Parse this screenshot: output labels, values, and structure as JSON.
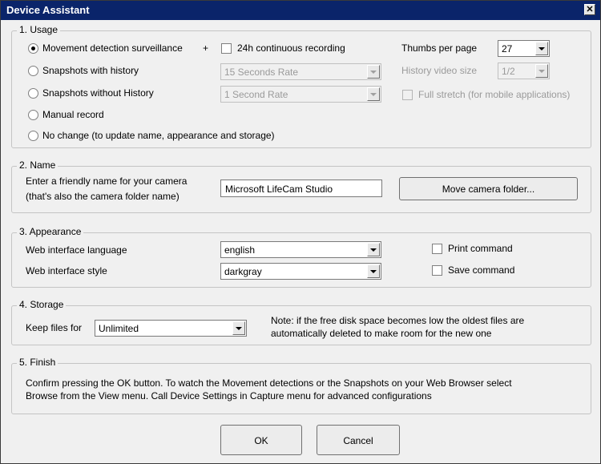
{
  "window": {
    "title": "Device Assistant",
    "close_glyph": "✕"
  },
  "usage": {
    "title": "1. Usage",
    "options": [
      {
        "label": "Movement detection surveillance",
        "selected": true
      },
      {
        "label": "Snapshots with history",
        "selected": false
      },
      {
        "label": "Snapshots without History",
        "selected": false
      },
      {
        "label": "Manual record",
        "selected": false
      },
      {
        "label": "No change (to update name, appearance and storage)",
        "selected": false
      }
    ],
    "plus": "+",
    "continuous_label": "24h continuous recording",
    "rate_with_history": "15 Seconds Rate",
    "rate_without_history": "1 Second Rate",
    "thumbs_label": "Thumbs per page",
    "thumbs_value": "27",
    "history_size_label": "History video size",
    "history_size_value": "1/2",
    "full_stretch_label": "Full stretch (for mobile applications)"
  },
  "name": {
    "title": "2. Name",
    "prompt_line1": "Enter a friendly name for your camera",
    "prompt_line2": "(that's also the camera folder name)",
    "camera_name": "Microsoft LifeCam Studio",
    "move_button": "Move camera folder..."
  },
  "appearance": {
    "title": "3. Appearance",
    "language_label": "Web interface language",
    "language_value": "english",
    "style_label": "Web interface style",
    "style_value": "darkgray",
    "print_label": "Print command",
    "save_label": "Save command"
  },
  "storage": {
    "title": "4. Storage",
    "keep_label": "Keep files for",
    "keep_value": "Unlimited",
    "note_line1": "Note: if the free disk space becomes low the oldest files are",
    "note_line2": "automatically deleted to make room for the new one"
  },
  "finish": {
    "title": "5. Finish",
    "line1": "Confirm pressing the OK button. To watch the Movement detections or the Snapshots on your Web Browser select",
    "line2": "Browse from the View menu. Call Device Settings in Capture menu for advanced configurations"
  },
  "buttons": {
    "ok": "OK",
    "cancel": "Cancel"
  }
}
